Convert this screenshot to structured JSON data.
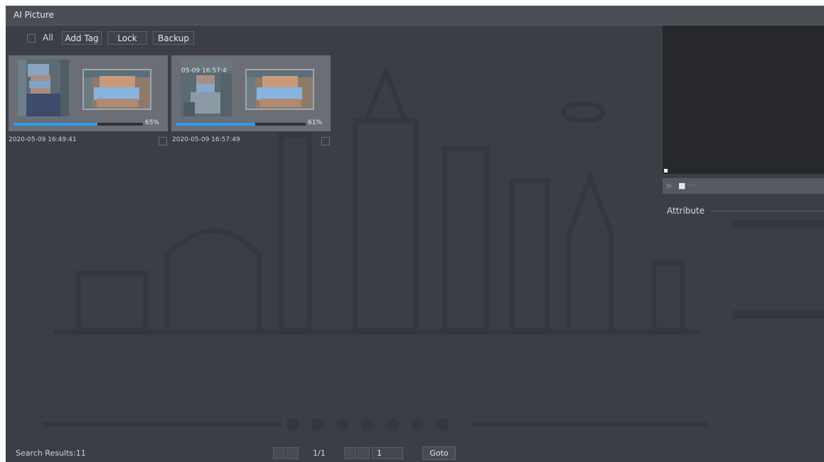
{
  "window": {
    "title": "AI Picture"
  },
  "toolbar": {
    "all_label": "All",
    "add_tag_label": "Add Tag",
    "lock_label": "Lock",
    "backup_label": "Backup"
  },
  "results": [
    {
      "overlay_time": "",
      "percent": "65%",
      "similarity": 0.65,
      "datetime": "2020-05-09 16:49:41"
    },
    {
      "overlay_time": "05-09 16:57:4",
      "percent": "61%",
      "similarity": 0.61,
      "datetime": "2020-05-09 16:57:49"
    }
  ],
  "panel": {
    "attribute_label": "Attribute"
  },
  "player_controls": {
    "play_icon": "▶",
    "stop_icon": "■",
    "waveform_icon": "〰"
  },
  "footer": {
    "search_results": "Search Results:11",
    "page_info": "1/1",
    "page_input_value": "1",
    "goto_label": "Goto"
  },
  "colors": {
    "accent": "#2a9df4",
    "background": "#3b3e45"
  }
}
